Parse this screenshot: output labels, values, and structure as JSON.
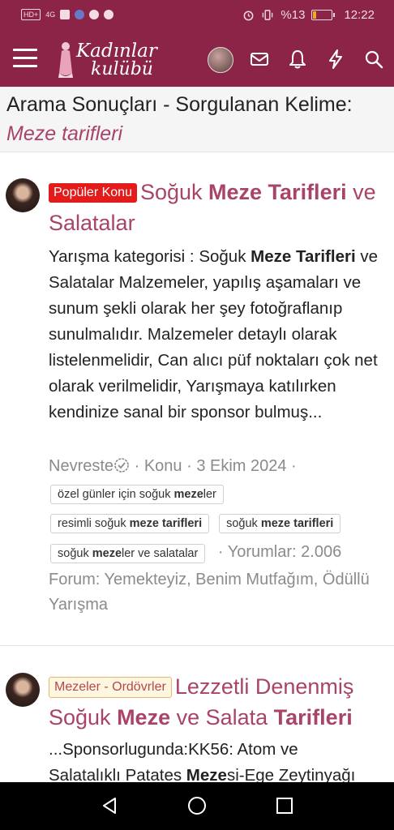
{
  "status_bar": {
    "network": "HD+",
    "signal": "4G",
    "battery_percent": "%13",
    "time": "12:22"
  },
  "app_bar": {
    "logo_line1": "Kadınlar",
    "logo_line2": "kulübü",
    "icons": [
      "menu-icon",
      "avatar",
      "mail-icon",
      "bell-icon",
      "bolt-icon",
      "search-icon"
    ]
  },
  "search_header": {
    "title": "Arama Sonuçları - Sorgulanan Kelime:",
    "query": "Meze tarifleri"
  },
  "results": [
    {
      "badge": "Popüler Konu",
      "title_parts": [
        "Soğuk ",
        "Meze Tarifleri",
        " ve Salatalar"
      ],
      "snippet_parts": [
        "Yarışma kategorisi : Soğuk ",
        "Meze Tarifleri",
        " ve Salatalar Malzemeler, yapılış aşamaları ve sunum şekli olarak her şey fotoğraflanıp sunulmalıdır. Malzemeler detaylı olarak listelenmelidir, Can alıcı püf noktaları çok net olarak verilmelidir, Yarışmaya katılırken kendinize sanal bir sponsor bulmuş..."
      ],
      "author": "Nevreste",
      "sep1": " · ",
      "type": "Konu",
      "date": "3 Ekim 2024",
      "tags": [
        {
          "pre": "özel günler için soğuk ",
          "bold": "meze",
          "post": "ler"
        },
        {
          "pre": "resimli soğuk ",
          "bold": "meze tarifleri",
          "post": ""
        },
        {
          "pre": "soğuk ",
          "bold": "meze tarifleri",
          "post": ""
        },
        {
          "pre": "soğuk ",
          "bold": "meze",
          "post": "ler ve salatalar"
        }
      ],
      "comments": "Yorumlar: 2.006",
      "forum": "Forum: Yemekteyiz, Benim Mutfağım, Ödüllü Yarışma"
    },
    {
      "badge": "Mezeler - Ordövrler",
      "title_parts": [
        "Lezzetli Denenmiş Soğuk ",
        "Meze",
        " ve Salata ",
        "Tarifleri"
      ],
      "snippet_line1": "...Sponsorlugunda:KK56: Atom ve",
      "snippet_line2_pre": "Salatalıklı Patates ",
      "snippet_line2_bold": "Meze",
      "snippet_line2_post": "si-Ege Zeytinyağı"
    }
  ],
  "nav_bar": {
    "buttons": [
      "back-icon",
      "home-icon",
      "recents-icon"
    ]
  }
}
